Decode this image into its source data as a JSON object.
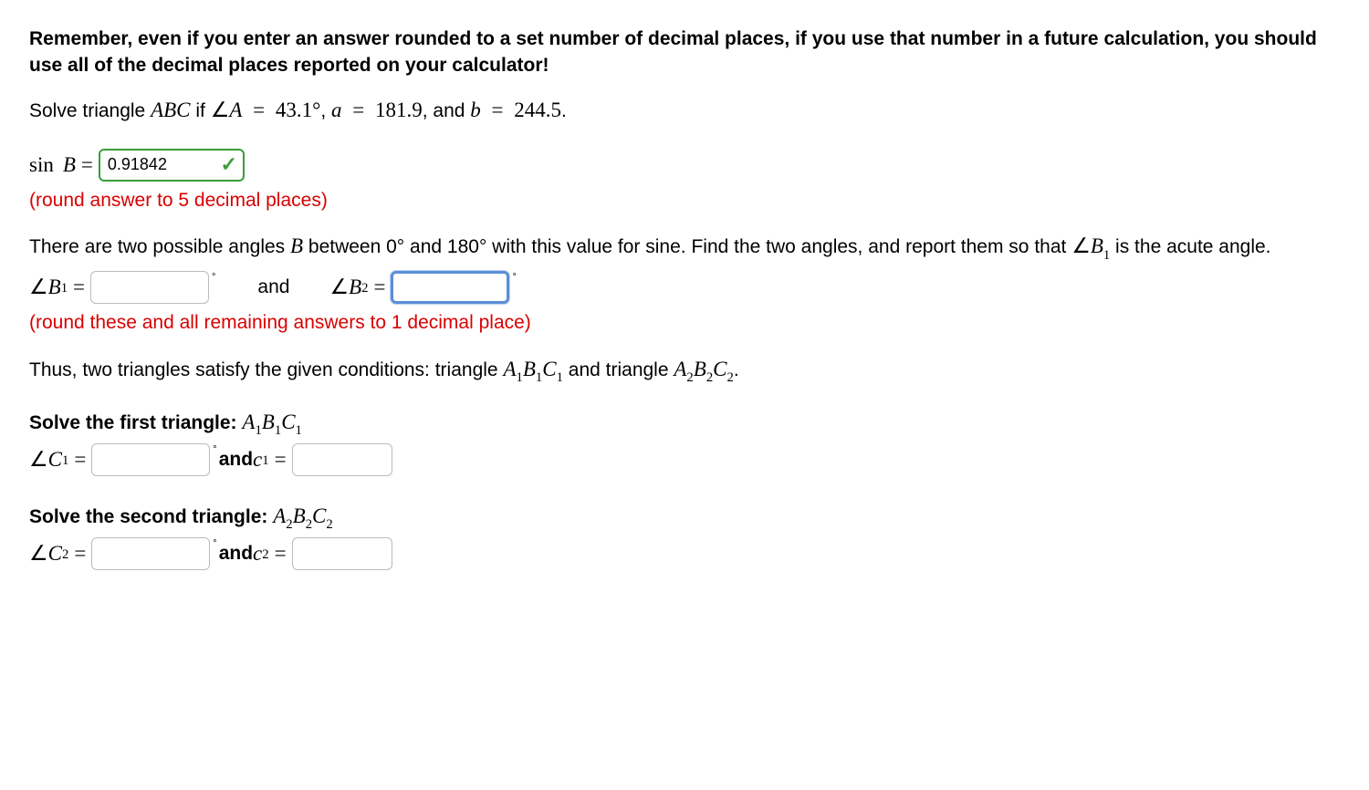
{
  "intro": {
    "reminder": "Remember, even if you enter an answer rounded to a set number of decimal places, if you use that number in a future calculation, you should use all of the decimal places reported on your calculator!"
  },
  "problem": {
    "prefix": "Solve triangle ",
    "triangle": "ABC",
    "given_if": " if ",
    "angle_sym": "∠",
    "angleA_label": "A",
    "eq": " = ",
    "angleA_value": "43.1",
    "deg": "°",
    "comma": ", ",
    "a_label": "a",
    "a_value": "181.9",
    "and_word": ", and ",
    "b_label": "b",
    "b_value": "244.5",
    "period": "."
  },
  "sinB": {
    "sin_label": "sin",
    "B_label": "B",
    "value": "0.91842",
    "note": "(round answer to 5 decimal places)"
  },
  "twoAngles": {
    "line1a": "There are two possible angles ",
    "B_label": "B",
    "line1b": " between 0° and 180° with this value for sine. Find the two angles, and report them so that ",
    "angle_sym": "∠",
    "B1_label": "B",
    "B1_sub": "1",
    "line1c": " is the acute angle.",
    "B2_label": "B",
    "B2_sub": "2",
    "and_word": "and",
    "note": "(round these and all remaining answers to 1 decimal place)",
    "b1_value": "",
    "b2_value": ""
  },
  "twoTriangles": {
    "intro_a": "Thus, two triangles satisfy the given conditions: triangle ",
    "t1": "A",
    "t1s": "1",
    "t1b": "B",
    "t1bs": "1",
    "t1c": "C",
    "t1cs": "1",
    "intro_mid": " and triangle ",
    "t2": "A",
    "t2s": "2",
    "t2b": "B",
    "t2bs": "2",
    "t2c": "C",
    "t2cs": "2",
    "intro_end": "."
  },
  "tri1": {
    "heading_prefix": "Solve the first triangle: ",
    "A": "A",
    "As": "1",
    "B": "B",
    "Bs": "1",
    "C": "C",
    "Cs": "1",
    "angle_sym": "∠",
    "C_label": "C",
    "C_sub": "1",
    "and_word": " and ",
    "c_label": "c",
    "c_sub": "1",
    "angleC_value": "",
    "c_value": ""
  },
  "tri2": {
    "heading_prefix": "Solve the second triangle: ",
    "A": "A",
    "As": "2",
    "B": "B",
    "Bs": "2",
    "C": "C",
    "Cs": "2",
    "angle_sym": "∠",
    "C_label": "C",
    "C_sub": "2",
    "and_word": " and ",
    "c_label": "c",
    "c_sub": "2",
    "angleC_value": "",
    "c_value": ""
  }
}
